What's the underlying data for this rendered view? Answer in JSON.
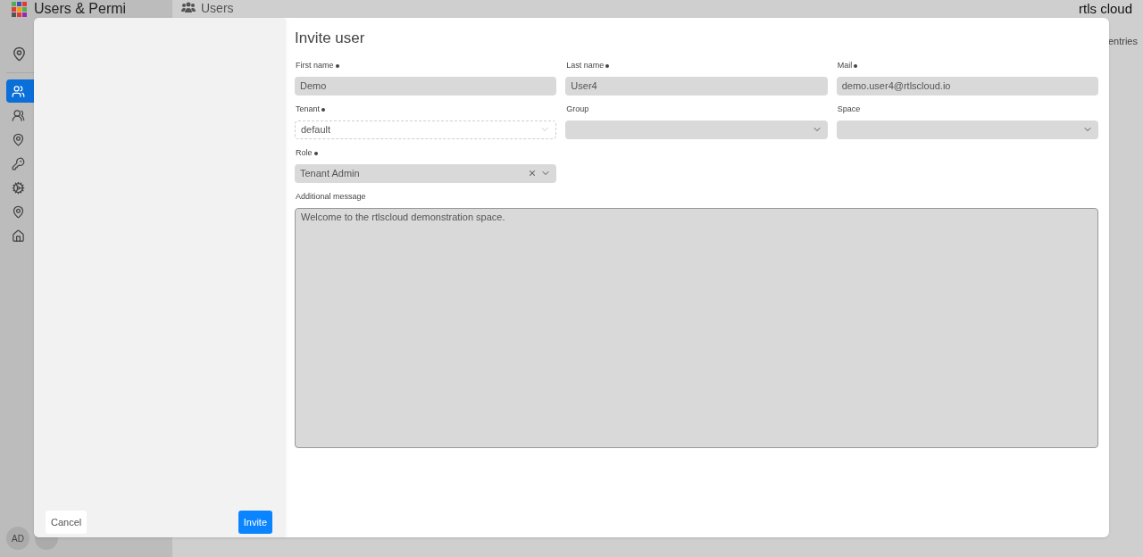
{
  "app": {
    "title": "Users & Permi",
    "header_title": "Users",
    "logo": "rtls cloud",
    "entries_label": "entries",
    "avatar": "AD",
    "sidebar": {
      "items": [
        {
          "selected": true
        },
        {
          "selected": false
        },
        {
          "selected": false
        },
        {
          "selected": false
        },
        {
          "selected": false
        },
        {
          "selected": false
        },
        {
          "selected": false
        }
      ]
    }
  },
  "modal": {
    "title": "Invite user",
    "fields": [
      {
        "label": "First name",
        "required": true,
        "kind": "text",
        "value": "Demo"
      },
      {
        "label": "Last name",
        "required": true,
        "kind": "text",
        "value": "User4"
      },
      {
        "label": "Mail",
        "required": true,
        "kind": "text",
        "value": "demo.user4@rtlscloud.io"
      },
      {
        "label": "Tenant",
        "required": true,
        "kind": "select",
        "value": "default",
        "disabled": true,
        "clearable": false
      },
      {
        "label": "Group",
        "required": false,
        "kind": "select",
        "disabled": false,
        "clearable": false
      },
      {
        "label": "Space",
        "required": false,
        "kind": "select",
        "disabled": false,
        "clearable": false
      },
      {
        "label": "Role",
        "required": true,
        "kind": "select",
        "value": "Tenant Admin",
        "disabled": false,
        "clearable": true
      }
    ],
    "message": {
      "label": "Additional message",
      "value": "Welcome to the rtlscloud demonstration space."
    },
    "buttons": {
      "cancel": "Cancel",
      "invite": "Invite"
    }
  }
}
